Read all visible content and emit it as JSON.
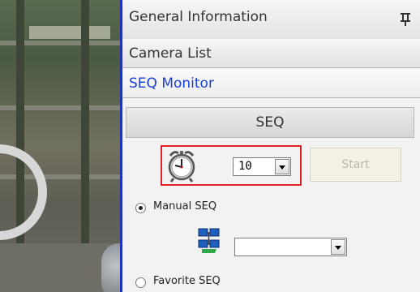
{
  "panel": {
    "headers": {
      "general_information": "General Information",
      "camera_list": "Camera List",
      "seq_monitor": "SEQ Monitor"
    },
    "seq_button_label": "SEQ",
    "interval": {
      "value": "10"
    },
    "start_button_label": "Start",
    "options": {
      "manual_label": "Manual SEQ",
      "favorite_label": "Favorite SEQ",
      "selected": "manual"
    },
    "icons": {
      "pin": "pin-icon",
      "clock": "alarm-clock-icon",
      "network": "network-computers-icon"
    },
    "colors": {
      "active_header": "#1a3fd6",
      "highlight_border": "#e02424",
      "camera_divider": "#1e34b5"
    }
  }
}
